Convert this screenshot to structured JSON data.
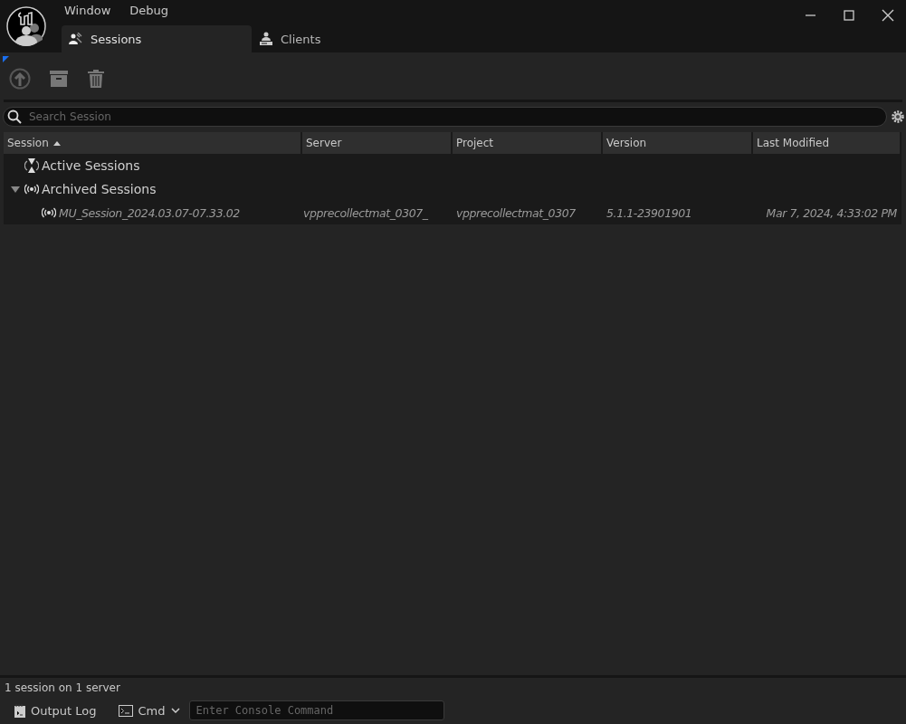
{
  "menu": [
    "Window",
    "Debug"
  ],
  "tabs": [
    {
      "label": "Sessions",
      "selected": true,
      "kind": "sessions"
    },
    {
      "label": "Clients",
      "selected": false,
      "kind": "clients"
    }
  ],
  "search": {
    "placeholder": "Search Session"
  },
  "table": {
    "columns": [
      {
        "label": "Session",
        "sorted": true
      },
      {
        "label": "Server",
        "sorted": false
      },
      {
        "label": "Project",
        "sorted": false
      },
      {
        "label": "Version",
        "sorted": false
      },
      {
        "label": "Last Modified",
        "sorted": false
      }
    ],
    "rows": [
      {
        "kind": "active",
        "label": "Active Sessions"
      },
      {
        "kind": "archived",
        "label": "Archived Sessions",
        "expanded": true,
        "children": [
          {
            "kind": "session",
            "cells": [
              "MU_Session_2024.03.07-07.33.02",
              "vpprecollectmat_0307_",
              "vpprecollectmat_0307",
              "5.1.1-23901901",
              "Mar 7, 2024, 4:33:02 PM"
            ]
          }
        ]
      }
    ]
  },
  "status_bar": "1 session on 1 server",
  "bottom_bar": {
    "output_log": "Output Log",
    "cmd": "Cmd",
    "console": {
      "placeholder": "Enter Console Command"
    }
  }
}
